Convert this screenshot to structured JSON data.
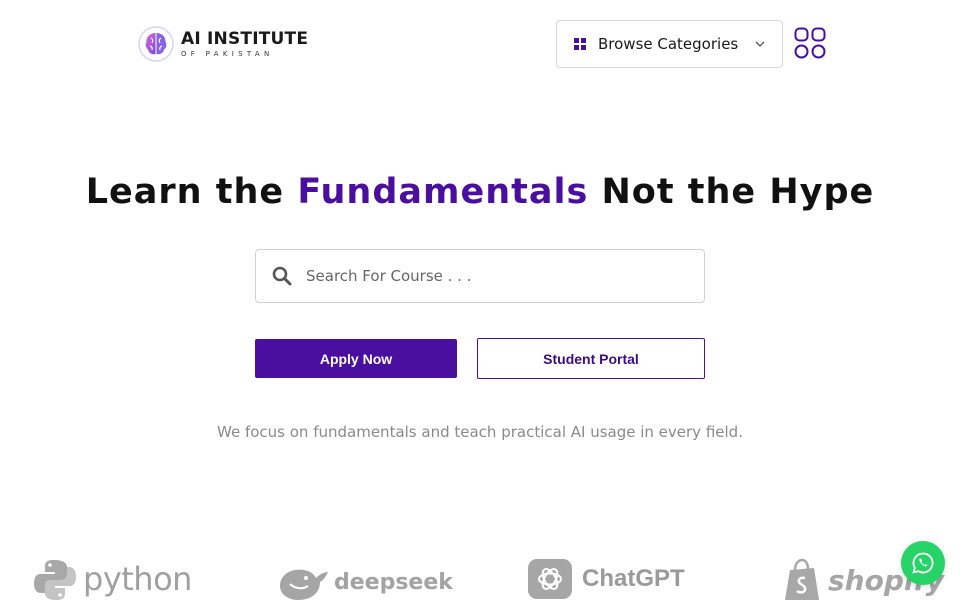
{
  "header": {
    "logo_title": "AI INSTITUTE",
    "logo_subtitle": "OF PAKISTAN",
    "browse_label": "Browse Categories"
  },
  "hero": {
    "headline_pre": "Learn the ",
    "headline_accent": "Fundamentals",
    "headline_post": " Not the Hype",
    "search_placeholder": "Search For Course . . .",
    "apply_label": "Apply Now",
    "portal_label": "Student Portal",
    "tagline": "We focus on fundamentals and teach practical AI usage in every field."
  },
  "brands": [
    {
      "name": "python",
      "icon": "python-logo-icon"
    },
    {
      "name": "deepseek",
      "icon": "deepseek-whale-icon"
    },
    {
      "name": "ChatGPT",
      "icon": "openai-knot-icon"
    },
    {
      "name": "shopify",
      "icon": "shopify-bag-icon"
    }
  ],
  "colors": {
    "accent": "#4b0fa0",
    "whatsapp": "#25d366"
  }
}
